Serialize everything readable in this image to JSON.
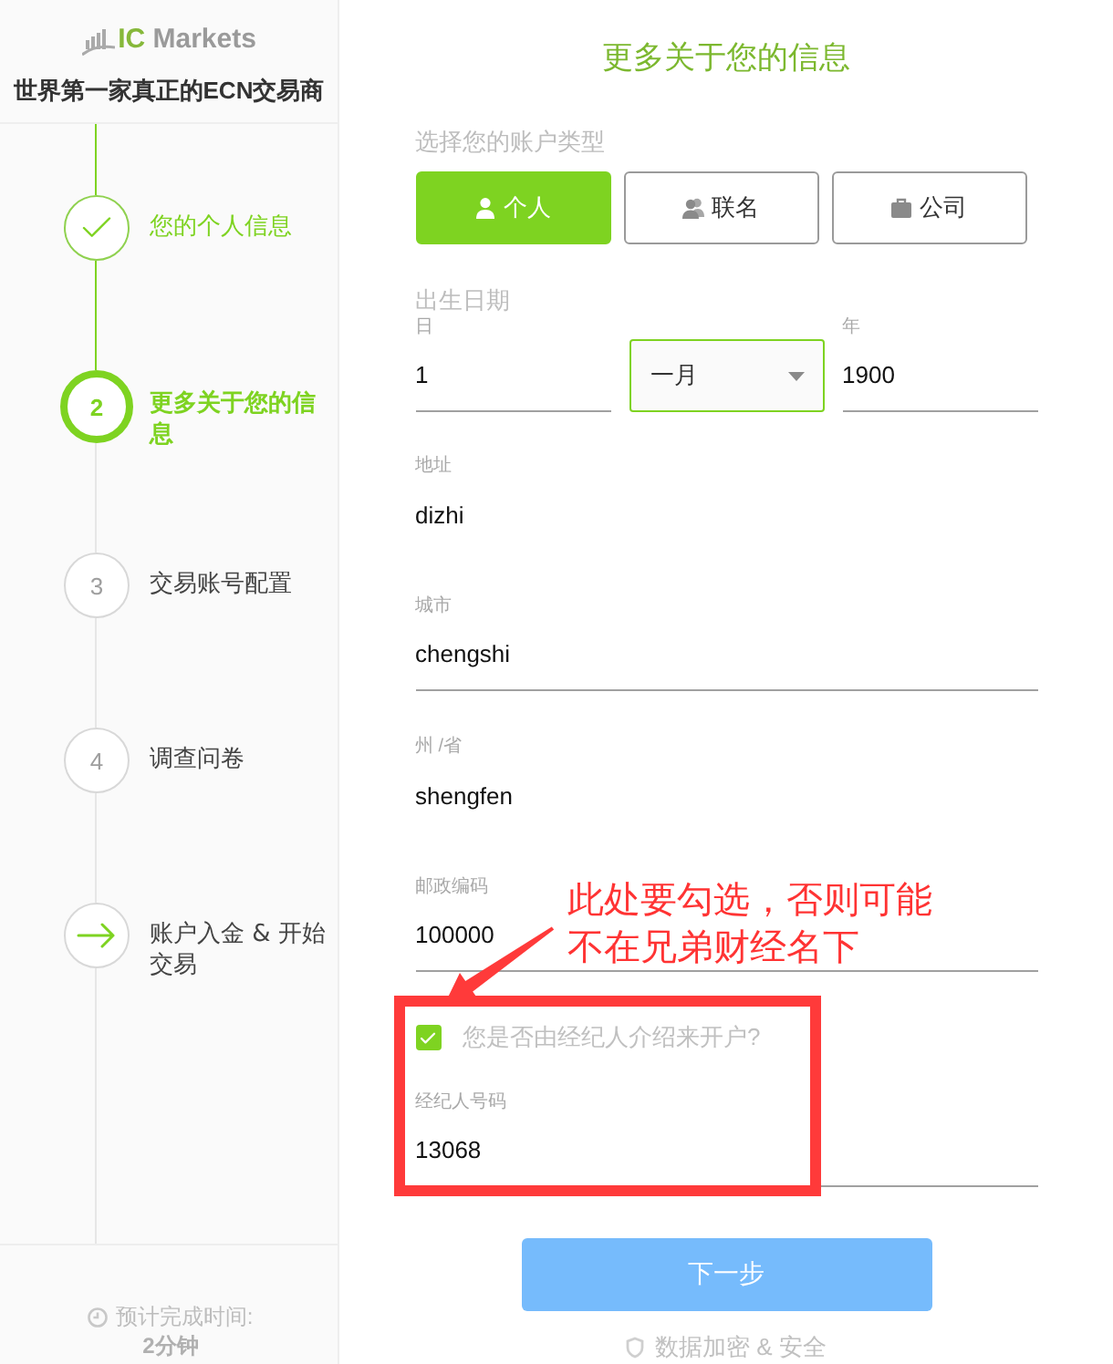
{
  "sidebar": {
    "logo": {
      "accent": "IC",
      "text": "Markets"
    },
    "tagline": "世界第一家真正的ECN交易商",
    "steps": [
      {
        "kind": "check",
        "current": false,
        "label": "您的个人信息"
      },
      {
        "kind": "number",
        "number": "2",
        "current": true,
        "label": "更多关于您的信息"
      },
      {
        "kind": "number",
        "number": "3",
        "current": false,
        "label": "交易账号配置"
      },
      {
        "kind": "number",
        "number": "4",
        "current": false,
        "label": "调查问卷"
      },
      {
        "kind": "arrow",
        "current": false,
        "label": "账户入金 & 开始交易"
      }
    ],
    "footer": {
      "estimate_label": "预计完成时间:",
      "estimate_value": "2分钟"
    }
  },
  "form": {
    "title": "更多关于您的信息",
    "account_type": {
      "label": "选择您的账户类型",
      "options": [
        {
          "kind": "person",
          "label": "个人",
          "selected": true
        },
        {
          "kind": "group",
          "label": "联名",
          "selected": false
        },
        {
          "kind": "briefcase",
          "label": "公司",
          "selected": false
        }
      ]
    },
    "birth_date": {
      "label": "出生日期",
      "day": {
        "label": "日",
        "value": "1",
        "underlined": true
      },
      "month": {
        "value": "一月",
        "focused": true
      },
      "year": {
        "label": "年",
        "value": "1900",
        "underlined": true
      }
    },
    "fields": [
      {
        "label": "地址",
        "value": "dizhi",
        "underlined": false
      },
      {
        "label": "城市",
        "value": "chengshi",
        "underlined": true
      },
      {
        "label": "州 /省",
        "value": "shengfen",
        "underlined": false
      },
      {
        "label": "邮政编码",
        "value": "100000",
        "underlined": true
      }
    ],
    "broker": {
      "checkbox": {
        "label": "您是否由经纪人介绍来开户?",
        "checked": true
      },
      "field": {
        "label": "经纪人号码",
        "value": "13068",
        "underlined": true
      }
    },
    "next_button": "下一步",
    "security_note": "数据加密 & 安全"
  },
  "annotation": {
    "text": "此处要勾选，否则可能不在兄弟财经名下"
  }
}
